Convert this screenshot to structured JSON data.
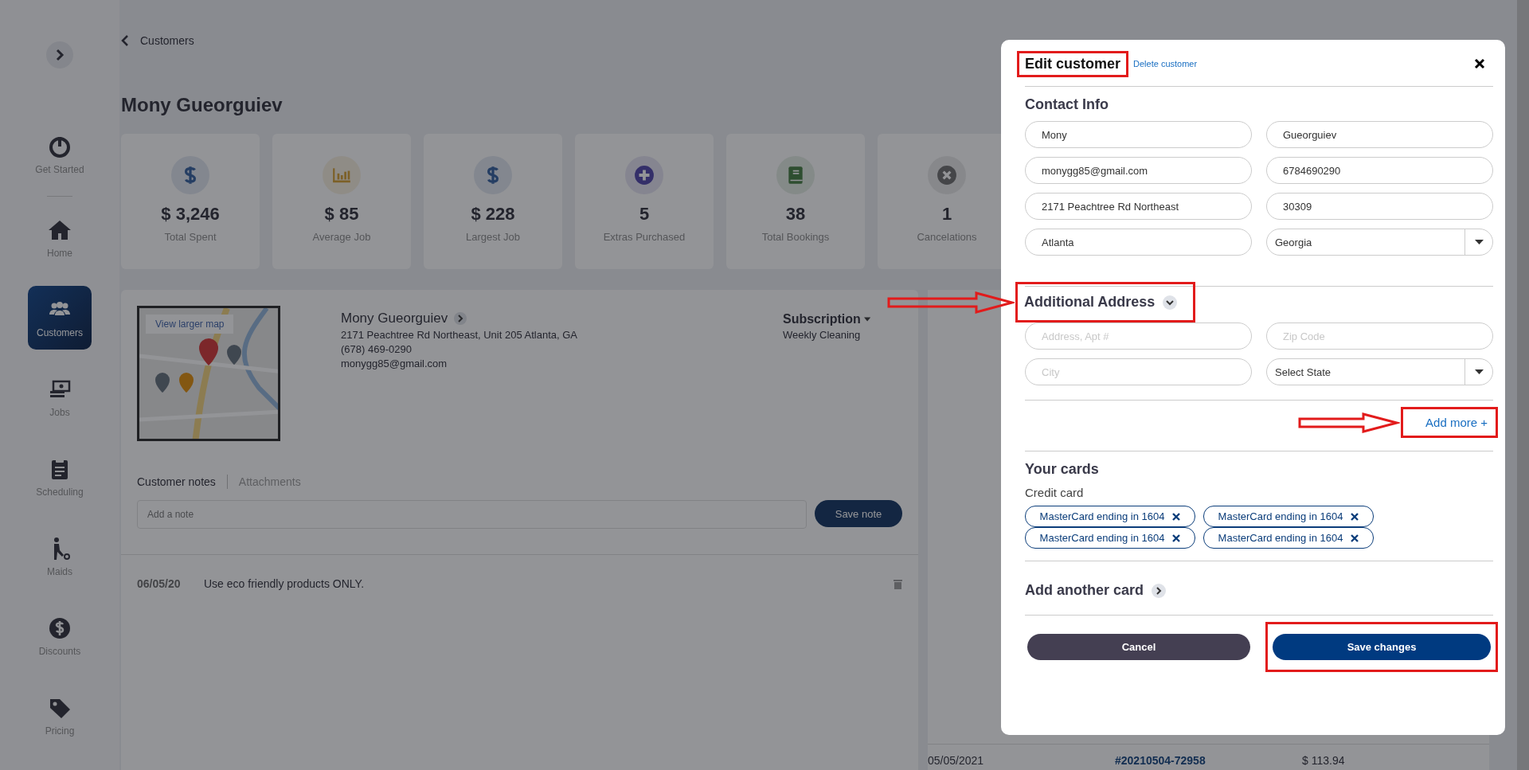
{
  "sidebar": {
    "items": [
      {
        "label": "Get Started",
        "selected": false
      },
      {
        "label": "Home",
        "selected": false
      },
      {
        "label": "Customers",
        "selected": true
      },
      {
        "label": "Jobs",
        "selected": false
      },
      {
        "label": "Scheduling",
        "selected": false
      },
      {
        "label": "Maids",
        "selected": false
      },
      {
        "label": "Discounts",
        "selected": false
      },
      {
        "label": "Pricing",
        "selected": false
      }
    ]
  },
  "breadcrumb": "Customers",
  "title": "Mony Gueorguiev",
  "stats": [
    {
      "value": "$ 3,246",
      "label": "Total Spent"
    },
    {
      "value": "$ 85",
      "label": "Average Job"
    },
    {
      "value": "$ 228",
      "label": "Largest Job"
    },
    {
      "value": "5",
      "label": "Extras Purchased"
    },
    {
      "value": "38",
      "label": "Total Bookings"
    },
    {
      "value": "1",
      "label": "Cancelations"
    }
  ],
  "customer": {
    "map_link": "View larger map",
    "name": "Mony Gueorguiev",
    "address": "2171 Peachtree Rd Northeast, Unit 205 Atlanta, GA",
    "phone": "(678) 469-0290",
    "email": "monygg85@gmail.com",
    "subscription": {
      "label": "Subscription",
      "plan": "Weekly Cleaning"
    }
  },
  "notes": {
    "tabs": [
      {
        "label": "Customer notes",
        "selected": true
      },
      {
        "label": "Attachments",
        "selected": false
      }
    ],
    "placeholder": "Add a note",
    "save_button": "Save note",
    "entries": [
      {
        "date": "06/05/20",
        "text": "Use eco friendly products ONLY."
      }
    ]
  },
  "jobs_table": {
    "rows": [
      {
        "date": "05/05/2021",
        "number": "#20210504-72958",
        "amount": "$ 113.94"
      }
    ]
  },
  "modal": {
    "title": {
      "text": "Edit customer",
      "highlighted": true
    },
    "delete_link": "Delete customer",
    "contact_info": {
      "heading": "Contact Info",
      "fields": [
        {
          "kind": "text",
          "value": "Mony"
        },
        {
          "kind": "text",
          "value": "Gueorguiev"
        },
        {
          "kind": "text",
          "value": "monygg85@gmail.com"
        },
        {
          "kind": "text",
          "value": "6784690290"
        },
        {
          "kind": "text",
          "value": "2171 Peachtree Rd Northeast"
        },
        {
          "kind": "text",
          "value": "30309"
        },
        {
          "kind": "text",
          "value": "Atlanta"
        },
        {
          "kind": "select",
          "value": "Georgia"
        }
      ]
    },
    "additional_address": {
      "heading": "Additional Address",
      "highlighted": true,
      "arrow": true,
      "fields": [
        {
          "kind": "text",
          "placeholder": "Address, Apt #"
        },
        {
          "kind": "text",
          "placeholder": "Zip Code"
        },
        {
          "kind": "text",
          "placeholder": "City"
        },
        {
          "kind": "select",
          "value": "Select State"
        }
      ]
    },
    "add_more": {
      "label": "Add more +",
      "highlighted": true,
      "arrow": true
    },
    "cards": {
      "heading": "Your cards",
      "subheading": "Credit card",
      "items": [
        {
          "label": "MasterCard ending in 1604"
        },
        {
          "label": "MasterCard ending in 1604"
        },
        {
          "label": "MasterCard ending in 1604"
        },
        {
          "label": "MasterCard ending in 1604"
        }
      ]
    },
    "add_card": "Add another card",
    "buttons": [
      {
        "kind": "secondary",
        "label": "Cancel",
        "highlighted": false
      },
      {
        "kind": "primary",
        "label": "Save changes",
        "highlighted": true
      }
    ]
  }
}
